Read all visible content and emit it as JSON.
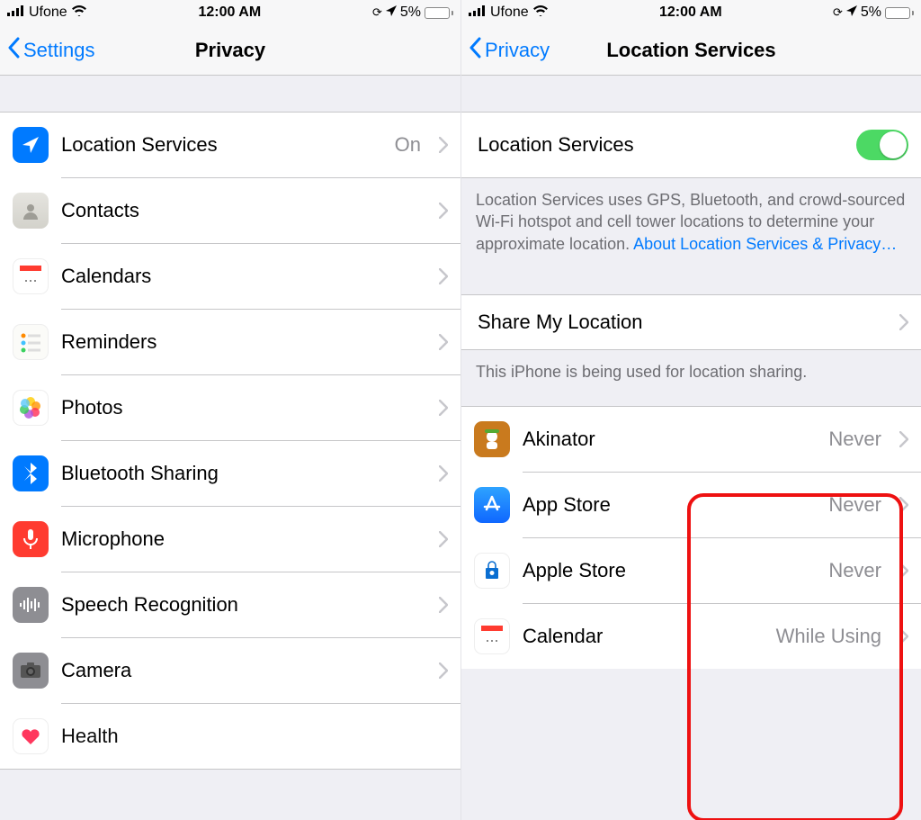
{
  "status": {
    "carrier": "Ufone",
    "time": "12:00 AM",
    "battery_pct": "5%"
  },
  "left": {
    "back_label": "Settings",
    "title": "Privacy",
    "items": {
      "location": {
        "label": "Location Services",
        "value": "On"
      },
      "contacts": {
        "label": "Contacts"
      },
      "calendars": {
        "label": "Calendars"
      },
      "reminders": {
        "label": "Reminders"
      },
      "photos": {
        "label": "Photos"
      },
      "bluetooth": {
        "label": "Bluetooth Sharing"
      },
      "microphone": {
        "label": "Microphone"
      },
      "speech": {
        "label": "Speech Recognition"
      },
      "camera": {
        "label": "Camera"
      },
      "health": {
        "label": "Health"
      }
    }
  },
  "right": {
    "back_label": "Privacy",
    "title": "Location Services",
    "master_label": "Location Services",
    "explain_text": "Location Services uses GPS, Bluetooth, and crowd-sourced Wi-Fi hotspot and cell tower locations to determine your approximate location. ",
    "explain_link": "About Location Services & Privacy…",
    "share_label": "Share My Location",
    "share_footer": "This iPhone is being used for location sharing.",
    "apps": {
      "akinator": {
        "label": "Akinator",
        "value": "Never"
      },
      "appstore": {
        "label": "App Store",
        "value": "Never"
      },
      "applestore": {
        "label": "Apple Store",
        "value": "Never"
      },
      "calendar": {
        "label": "Calendar",
        "value": "While Using"
      }
    }
  }
}
